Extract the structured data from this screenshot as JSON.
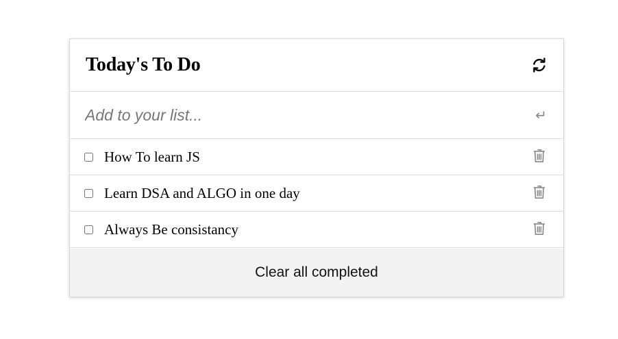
{
  "header": {
    "title": "Today's To Do",
    "refresh_icon": "refresh-icon"
  },
  "input": {
    "placeholder": "Add to your list...",
    "value": "",
    "enter_icon": "enter-icon",
    "enter_glyph": "↵"
  },
  "items": [
    {
      "text": "How To learn JS",
      "completed": false,
      "delete_icon": "trash-icon"
    },
    {
      "text": "Learn DSA and ALGO in one day",
      "completed": false,
      "delete_icon": "trash-icon"
    },
    {
      "text": "Always Be consistancy",
      "completed": false,
      "delete_icon": "trash-icon"
    }
  ],
  "footer": {
    "clear_label": "Clear all completed"
  },
  "colors": {
    "border": "#dcdcdc",
    "footer_bg": "#f3f3f3",
    "icon_gray": "#888888"
  }
}
